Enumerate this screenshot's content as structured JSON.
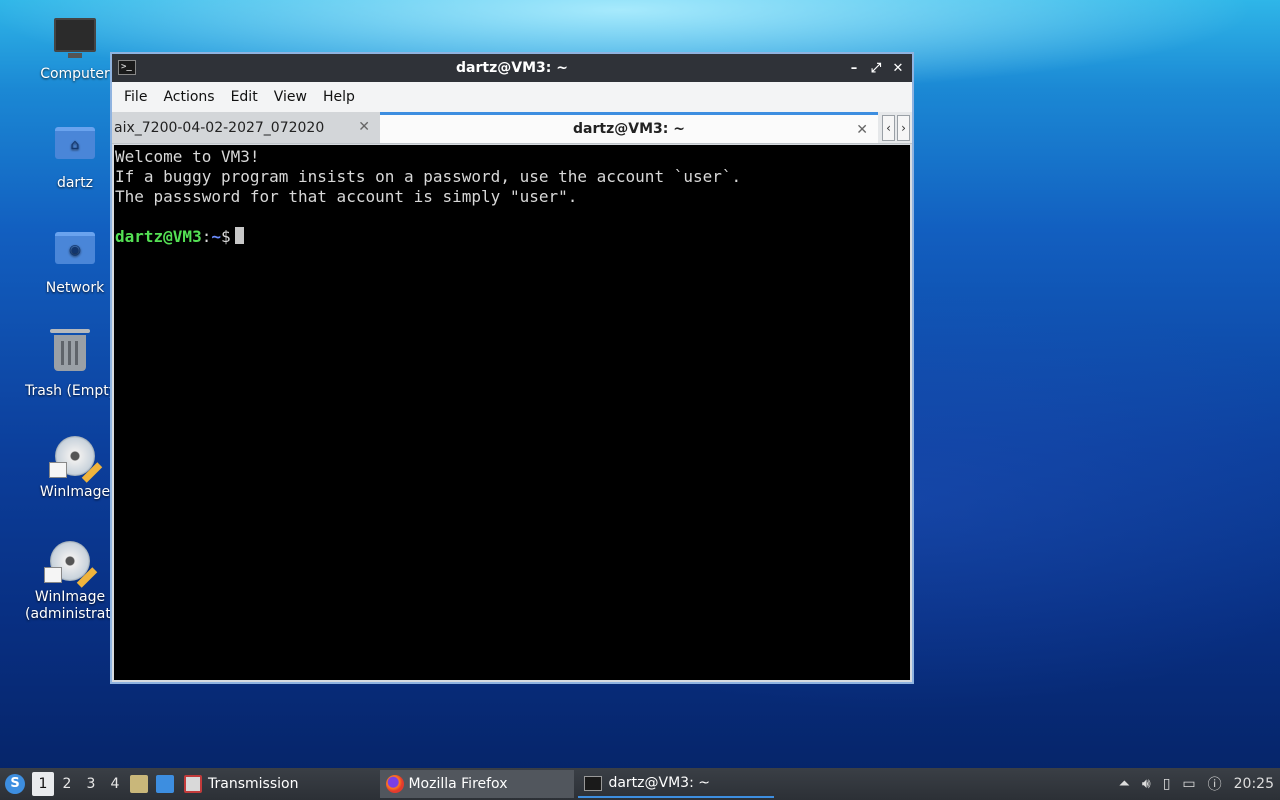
{
  "desktop": {
    "icons": [
      {
        "label": "Computer",
        "icon": "computer-icon"
      },
      {
        "label": "dartz",
        "icon": "home-folder-icon"
      },
      {
        "label": "Network",
        "icon": "network-folder-icon"
      },
      {
        "label": "Trash (Empty)",
        "icon": "trash-icon"
      },
      {
        "label": "WinImage",
        "icon": "winimage-icon"
      },
      {
        "label": "WinImage (administrator)",
        "icon": "winimage-admin-icon"
      }
    ]
  },
  "window": {
    "title": "dartz@VM3: ~",
    "controls": {
      "minimize": "–",
      "maximize": "⤢",
      "close": "✕"
    },
    "menu": [
      "File",
      "Actions",
      "Edit",
      "View",
      "Help"
    ],
    "tabs": [
      {
        "label": "aix_7200-04-02-2027_072020",
        "active": false
      },
      {
        "label": "dartz@VM3: ~",
        "active": true
      }
    ],
    "terminal": {
      "lines": [
        "Welcome to VM3!",
        "If a buggy program insists on a password, use the account `user`.",
        "The passsword for that account is simply \"user\"."
      ],
      "prompt_user": "dartz@VM3",
      "prompt_sep": ":",
      "prompt_path": "~",
      "prompt_symbol": "$"
    }
  },
  "taskbar": {
    "workspaces": [
      "1",
      "2",
      "3",
      "4"
    ],
    "active_workspace": "1",
    "launchers": [
      {
        "name": "file-manager-icon"
      },
      {
        "name": "show-desktop-icon"
      }
    ],
    "apps": [
      {
        "label": "Transmission",
        "icon": "transmission-icon"
      }
    ],
    "tasks": [
      {
        "label": "Mozilla Firefox",
        "icon": "firefox-icon",
        "state": "minimized"
      },
      {
        "label": "dartz@VM3: ~",
        "icon": "terminal-icon",
        "state": "active"
      }
    ],
    "tray": [
      "up-arrow-icon",
      "volume-icon",
      "clipboard-icon",
      "network-icon",
      "update-icon"
    ],
    "clock": "20:25"
  }
}
